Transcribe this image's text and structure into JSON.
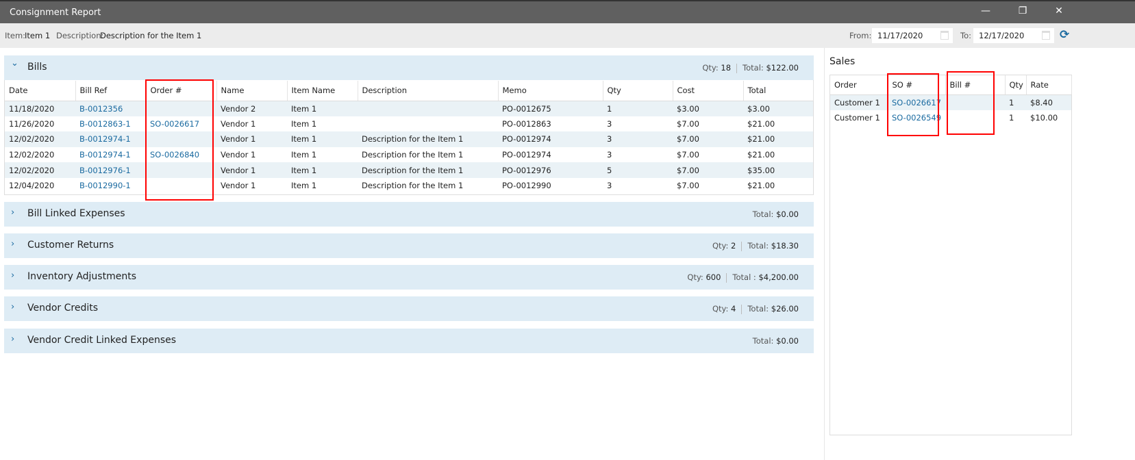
{
  "window": {
    "title": "Consignment Report",
    "minimize": "—",
    "restore": "❐",
    "close": "✕"
  },
  "toolbar": {
    "item_label": "Item:",
    "item_value": "Item 1",
    "desc_label": "Description:",
    "desc_value": "Description for the Item 1",
    "from_label": "From:",
    "from_value": "11/17/2020",
    "to_label": "To:",
    "to_value": "12/17/2020"
  },
  "bills": {
    "title": "Bills",
    "qty_label": "Qty:",
    "qty": "18",
    "total_label": "Total:",
    "total": "$122.00",
    "columns": [
      "Date",
      "Bill Ref",
      "Order #",
      "Name",
      "Item Name",
      "Description",
      "Memo",
      "Qty",
      "Cost",
      "Total"
    ],
    "rows": [
      [
        "11/18/2020",
        "B-0012356",
        "",
        "Vendor 2",
        "Item 1",
        "",
        "PO-0012675",
        "1",
        "$3.00",
        "$3.00"
      ],
      [
        "11/26/2020",
        "B-0012863-1",
        "SO-0026617",
        "Vendor 1",
        "Item 1",
        "",
        "PO-0012863",
        "3",
        "$7.00",
        "$21.00"
      ],
      [
        "12/02/2020",
        "B-0012974-1",
        "",
        "Vendor 1",
        "Item 1",
        "Description for the Item 1",
        "PO-0012974",
        "3",
        "$7.00",
        "$21.00"
      ],
      [
        "12/02/2020",
        "B-0012974-1",
        "SO-0026840",
        "Vendor 1",
        "Item 1",
        "Description for the Item 1",
        "PO-0012974",
        "3",
        "$7.00",
        "$21.00"
      ],
      [
        "12/02/2020",
        "B-0012976-1",
        "",
        "Vendor 1",
        "Item 1",
        "Description for the Item 1",
        "PO-0012976",
        "5",
        "$7.00",
        "$35.00"
      ],
      [
        "12/04/2020",
        "B-0012990-1",
        "",
        "Vendor 1",
        "Item 1",
        "Description for the Item 1",
        "PO-0012990",
        "3",
        "$7.00",
        "$21.00"
      ]
    ]
  },
  "sections": [
    {
      "title": "Bill Linked Expenses",
      "total_label": "Total:",
      "total": "$0.00"
    },
    {
      "title": "Customer Returns",
      "qty_label": "Qty:",
      "qty": "2",
      "total_label": "Total:",
      "total": "$18.30"
    },
    {
      "title": "Inventory Adjustments",
      "qty_label": "Qty:",
      "qty": "600",
      "total_label": "Total :",
      "total": "$4,200.00"
    },
    {
      "title": "Vendor Credits",
      "qty_label": "Qty:",
      "qty": "4",
      "total_label": "Total:",
      "total": "$26.00"
    },
    {
      "title": "Vendor Credit Linked Expenses",
      "total_label": "Total:",
      "total": "$0.00"
    }
  ],
  "sales": {
    "title": "Sales",
    "columns": [
      "Order",
      "SO #",
      "Bill #",
      "Qty",
      "Rate"
    ],
    "rows": [
      [
        "Customer 1",
        "SO-0026617",
        "",
        "1",
        "$8.40"
      ],
      [
        "Customer 1",
        "SO-0026549",
        "",
        "1",
        "$10.00"
      ]
    ]
  }
}
